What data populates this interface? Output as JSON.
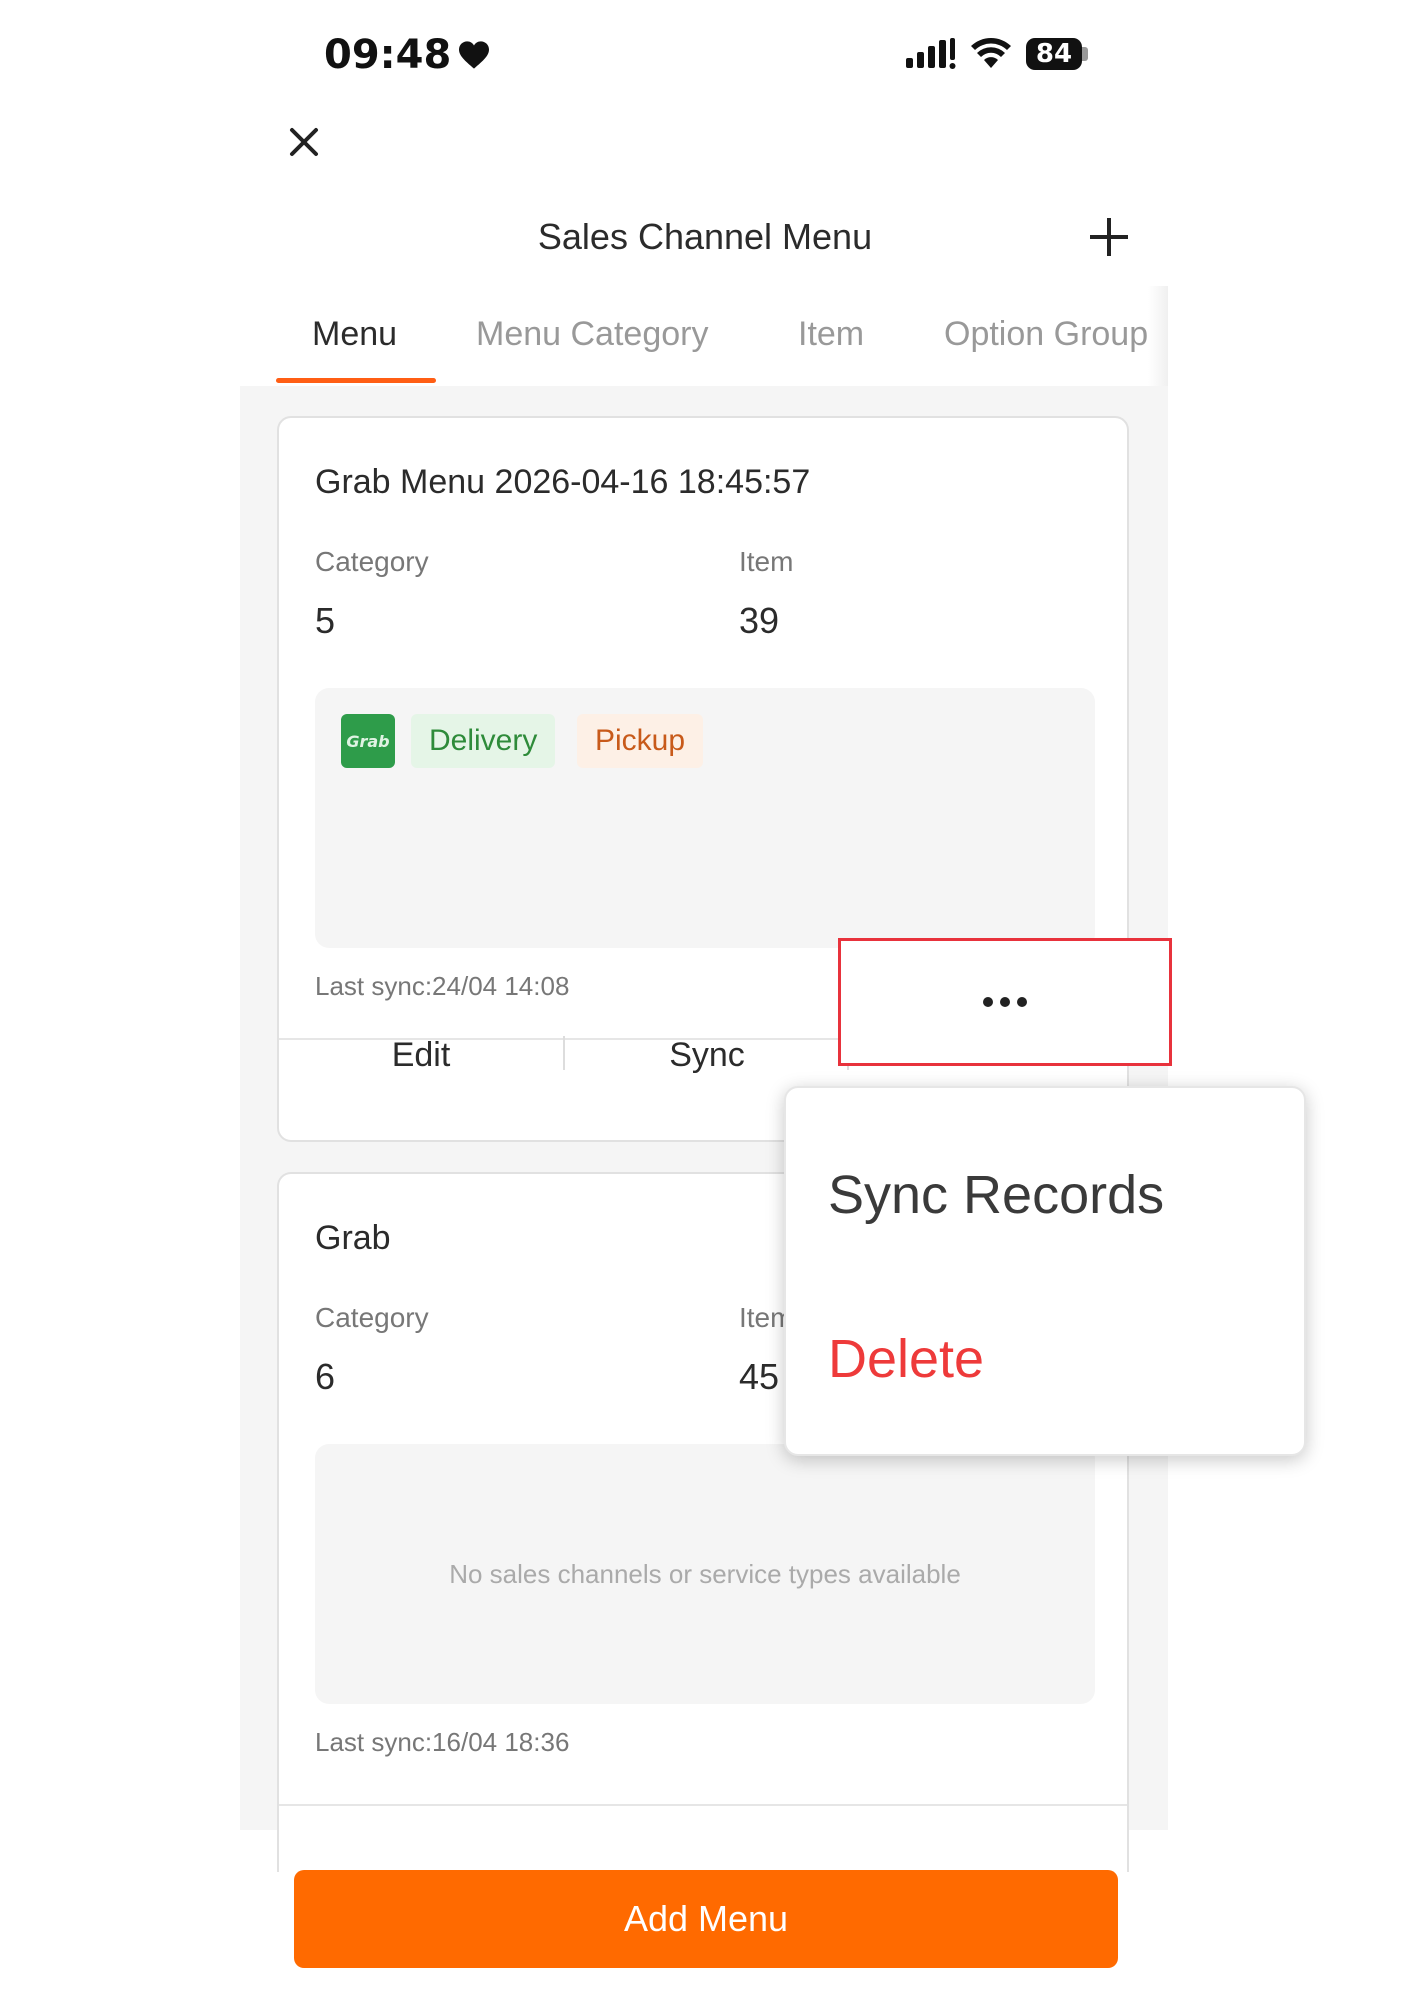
{
  "status_bar": {
    "time": "09:48",
    "battery": "84"
  },
  "header": {
    "title": "Sales Channel Menu"
  },
  "tabs": [
    {
      "label": "Menu",
      "active": true
    },
    {
      "label": "Menu Category",
      "active": false
    },
    {
      "label": "Item",
      "active": false
    },
    {
      "label": "Option Group",
      "active": false
    }
  ],
  "cards": [
    {
      "title": "Grab Menu 2026-04-16 18:45:57",
      "category_label": "Category",
      "category_count": "5",
      "item_label": "Item",
      "item_count": "39",
      "channel_logo": "Grab",
      "tags": [
        "Delivery",
        "Pickup"
      ],
      "last_sync": "Last sync:24/04 14:08",
      "actions": {
        "edit": "Edit",
        "sync": "Sync"
      }
    },
    {
      "title": "Grab",
      "category_label": "Category",
      "category_count": "6",
      "item_label": "Item",
      "item_count": "45",
      "empty_message": "No sales channels or service types available",
      "last_sync": "Last sync:16/04 18:36"
    }
  ],
  "popup_menu": {
    "items": [
      {
        "label": "Sync Records",
        "color": "#3a3a3a"
      },
      {
        "label": "Delete",
        "color": "#ee3a3a"
      }
    ]
  },
  "footer": {
    "add_button": "Add Menu"
  },
  "colors": {
    "accent": "#ff6a00",
    "tab_underline": "#ff5e14",
    "highlight": "#e8323c",
    "grab_green": "#2e9c4a"
  },
  "icons": [
    "heart-icon",
    "cellular-signal-icon",
    "wifi-icon",
    "battery-icon",
    "close-icon",
    "plus-icon",
    "more-dots-icon"
  ]
}
